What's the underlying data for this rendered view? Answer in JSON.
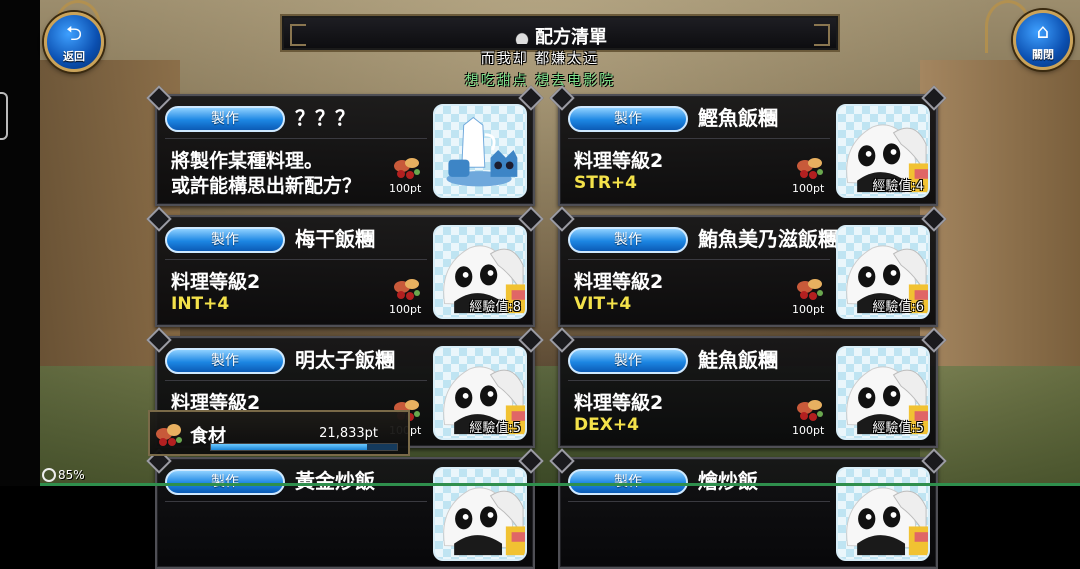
{
  "top_bar": {
    "title": "配方清單",
    "back_label": "返回",
    "close_label": "關閉"
  },
  "chat": {
    "line1": "而我却 都嫌太远",
    "line2": "想吃甜点 想去电影院"
  },
  "cards": [
    {
      "button": "製作",
      "name": "？？？",
      "line1": "將製作某種料理。",
      "line2": "或許能構思出新配方？",
      "stat": "",
      "cost": "100pt",
      "exp": "",
      "thumb": "teaset"
    },
    {
      "button": "製作",
      "name": "鰹魚飯糰",
      "line1": "料理等級2",
      "line2": "",
      "stat": "STR+4",
      "cost": "100pt",
      "exp": "經驗值:4",
      "thumb": "onigiri"
    },
    {
      "button": "製作",
      "name": "梅干飯糰",
      "line1": "料理等級2",
      "line2": "",
      "stat": "INT+4",
      "cost": "100pt",
      "exp": "經驗值:8",
      "thumb": "onigiri"
    },
    {
      "button": "製作",
      "name": "鮪魚美乃滋飯糰",
      "line1": "料理等級2",
      "line2": "",
      "stat": "VIT+4",
      "cost": "100pt",
      "exp": "經驗值:6",
      "thumb": "onigiri"
    },
    {
      "button": "製作",
      "name": "明太子飯糰",
      "line1": "料理等級2",
      "line2": "",
      "stat": "",
      "cost": "100pt",
      "exp": "經驗值:5",
      "thumb": "onigiri"
    },
    {
      "button": "製作",
      "name": "鮭魚飯糰",
      "line1": "料理等級2",
      "line2": "",
      "stat": "DEX+4",
      "cost": "100pt",
      "exp": "經驗值:5",
      "thumb": "onigiri"
    },
    {
      "button": "製作",
      "name": "黃金炒飯",
      "line1": "",
      "line2": "",
      "stat": "",
      "cost": "",
      "exp": "",
      "thumb": "onigiri"
    },
    {
      "button": "製作",
      "name": "燴炒飯",
      "line1": "",
      "line2": "",
      "stat": "",
      "cost": "",
      "exp": "",
      "thumb": "onigiri"
    }
  ],
  "ingredients": {
    "label": "食材",
    "value": "21,833pt",
    "fill_fraction": 0.84
  },
  "status": {
    "battery": "85%"
  },
  "icons": {
    "back": "back-arrow-icon",
    "close": "home-icon",
    "title": "pot-icon",
    "cost": "ingredients-icon"
  },
  "colors": {
    "button_blue": "#1c86e3",
    "stat_yellow": "#f4e24a",
    "chat_green": "#7ddf8a"
  }
}
